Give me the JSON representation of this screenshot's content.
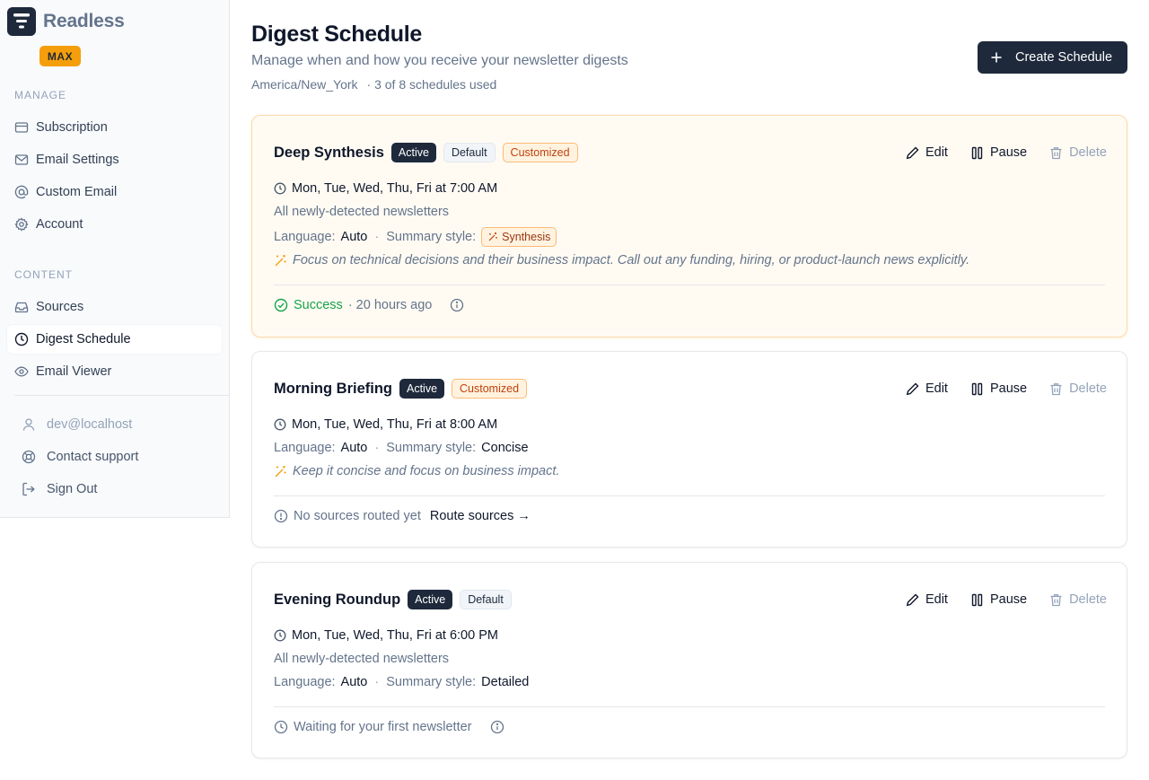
{
  "app": {
    "name": "Readless",
    "plan": "MAX"
  },
  "sidebar": {
    "manage_label": "MANAGE",
    "manage": [
      {
        "label": "Subscription",
        "icon": "credit-card-icon"
      },
      {
        "label": "Email Settings",
        "icon": "mail-icon"
      },
      {
        "label": "Custom Email",
        "icon": "at-sign-icon"
      },
      {
        "label": "Account",
        "icon": "gear-icon"
      }
    ],
    "content_label": "CONTENT",
    "content": [
      {
        "label": "Sources",
        "icon": "inbox-icon"
      },
      {
        "label": "Digest Schedule",
        "icon": "clock-icon",
        "active": true
      },
      {
        "label": "Email Viewer",
        "icon": "eye-icon"
      }
    ],
    "user_email": "dev@localhost",
    "contact_support": "Contact support",
    "sign_out": "Sign Out"
  },
  "header": {
    "title": "Digest Schedule",
    "subtitle": "Manage when and how you receive your newsletter digests",
    "timezone": "America/New_York",
    "usage": "· 3 of 8 schedules used",
    "create_label": "Create Schedule"
  },
  "labels": {
    "edit": "Edit",
    "pause": "Pause",
    "delete": "Delete",
    "language": "Language:",
    "summary_style": "Summary style:",
    "separator": "·"
  },
  "schedules": [
    {
      "name": "Deep Synthesis",
      "badges": [
        "Active",
        "Default",
        "Customized"
      ],
      "schedule": "Mon, Tue, Wed, Thu, Fri at 7:00 AM",
      "sources": "All newly-detected newsletters",
      "language": "Auto",
      "style": "Synthesis",
      "instructions": "Focus on technical decisions and their business impact. Call out any funding, hiring, or product-launch news explicitly.",
      "status_label": "Success",
      "status_time": "· 20 hours ago"
    },
    {
      "name": "Morning Briefing",
      "badges": [
        "Active",
        "Customized"
      ],
      "schedule": "Mon, Tue, Wed, Thu, Fri at 8:00 AM",
      "language": "Auto",
      "style": "Concise",
      "instructions": "Keep it concise and focus on business impact.",
      "status_label": "No sources routed yet",
      "route_link": "Route sources →"
    },
    {
      "name": "Evening Roundup",
      "badges": [
        "Active",
        "Default"
      ],
      "schedule": "Mon, Tue, Wed, Thu, Fri at 6:00 PM",
      "sources": "All newly-detected newsletters",
      "language": "Auto",
      "style": "Detailed",
      "status_label": "Waiting for your first newsletter"
    }
  ]
}
